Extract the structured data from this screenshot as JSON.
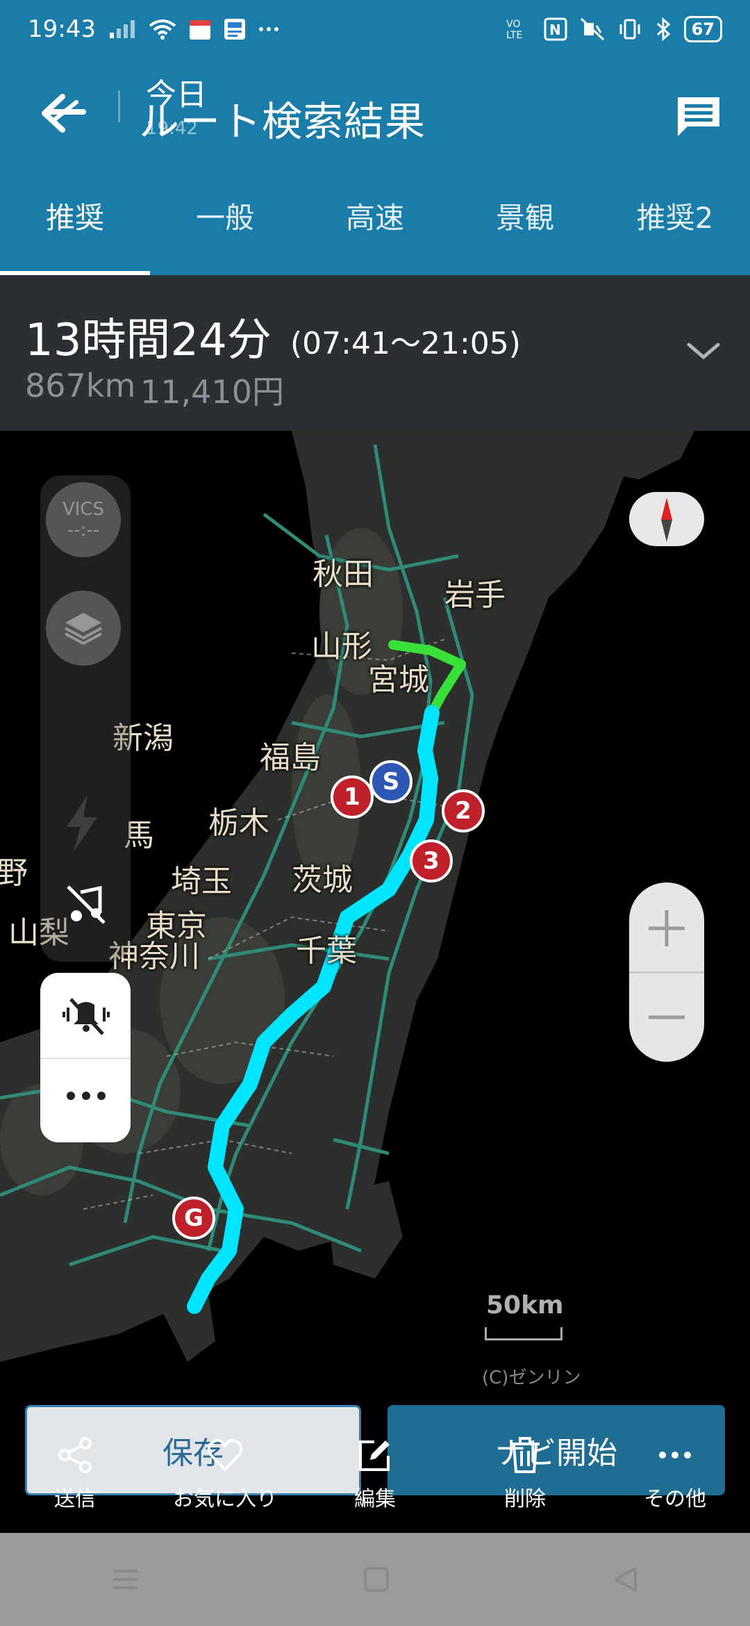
{
  "status_bar": {
    "time": "19:43",
    "battery": "67",
    "left_icons": [
      "signal-icon",
      "wifi-icon",
      "calendar-icon",
      "news-icon",
      "more-icon"
    ],
    "right_icons": [
      "volte-icon",
      "nfc-icon",
      "vibrate-off-icon",
      "vibrate-icon",
      "bluetooth-icon",
      "battery-icon"
    ]
  },
  "header": {
    "date": "今日",
    "time": "19:42",
    "title": "ルート検索結果"
  },
  "tabs": [
    {
      "label": "推奨",
      "active": true
    },
    {
      "label": "一般",
      "active": false
    },
    {
      "label": "高速",
      "active": false
    },
    {
      "label": "景観",
      "active": false
    },
    {
      "label": "推奨2",
      "active": false
    }
  ],
  "summary": {
    "duration": "13時間24分",
    "timespan": "(07:41〜21:05)",
    "distance": "867km",
    "toll": "11,410円"
  },
  "map": {
    "vics_label": "VICS",
    "vics_value": "--:--",
    "prefectures": [
      "秋田",
      "岩手",
      "山形",
      "宮城",
      "新潟",
      "福島",
      "栃木",
      "馬",
      "茨城",
      "埼玉",
      "野",
      "東京",
      "千葉",
      "山梨",
      "神奈川"
    ],
    "scale": "50km",
    "copyright": "(C)ゼンリン",
    "markers": {
      "start": "S",
      "goal": "G",
      "waypoints": [
        "1",
        "2",
        "3"
      ]
    },
    "route_color": "#00e5ff",
    "route_start_color": "#39e03a"
  },
  "actions": {
    "save": "保存",
    "start_navi": "ナビ開始"
  },
  "bottom_bar": [
    {
      "label": "送信",
      "icon": "share-icon"
    },
    {
      "label": "お気に入り",
      "icon": "heart-icon"
    },
    {
      "label": "編集",
      "icon": "edit-icon"
    },
    {
      "label": "削除",
      "icon": "trash-icon"
    },
    {
      "label": "その他",
      "icon": "more-icon"
    }
  ]
}
